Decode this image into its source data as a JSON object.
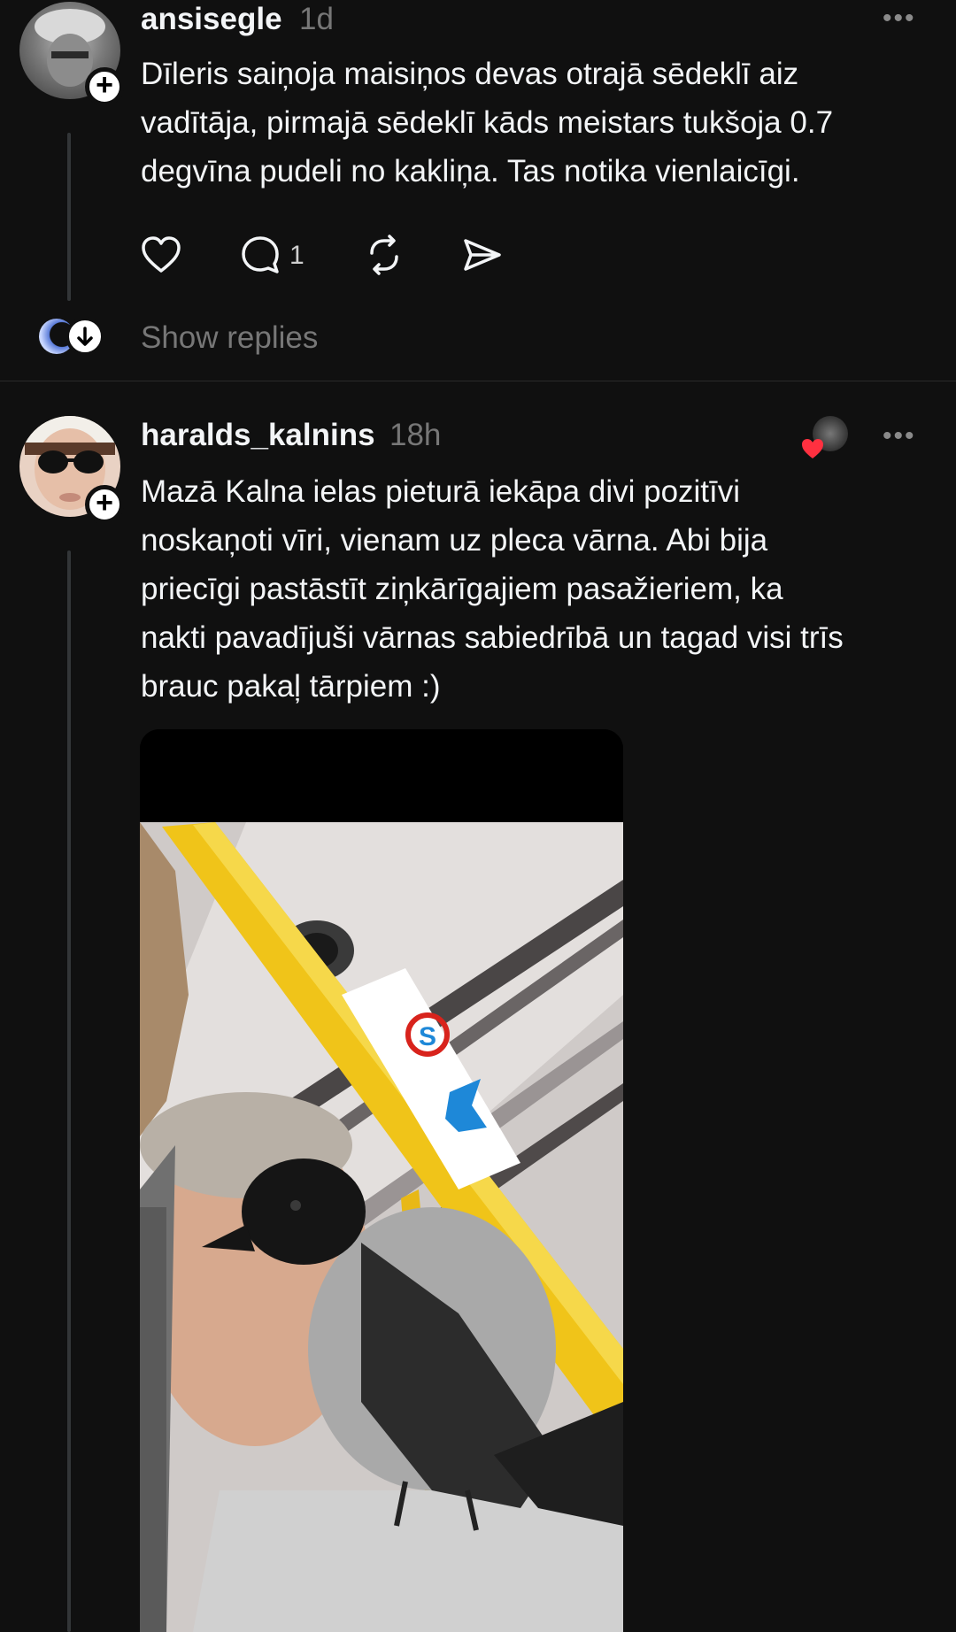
{
  "post1": {
    "username": "ansisegle",
    "time": "1d",
    "text": "Dīleris saiņoja maisiņos devas otrajā sēdeklī aiz\nvadītāja, pirmajā sēdeklī kāds meistars tukšoja 0.7\ndegvīna pudeli no kakliņa. Tas notika vienlaicīgi.",
    "actions": {
      "like_icon": "heart-icon",
      "reply_icon": "comment-icon",
      "reply_count": "1",
      "repost_icon": "repost-icon",
      "share_icon": "send-icon"
    },
    "show_replies_label": "Show replies",
    "more_icon": "more-dots-icon"
  },
  "post2": {
    "username": "haralds_kalnins",
    "time": "18h",
    "text": "Mazā Kalna ielas pieturā iekāpa divi pozitīvi\nnoskaņoti vīri, vienam uz pleca vārna. Abi bija\npriecīgi pastāstīt ziņkārīgajiem pasažieriem, ka\nnakti pavadījuši vārnas sabiedrībā un tagad visi trīs\nbrauc pakaļ tārpiem :)",
    "liked_by_icon": "liked-by-avatar-heart",
    "more_icon": "more-dots-icon"
  },
  "colors": {
    "background": "#101010",
    "text": "#f3f5f7",
    "muted": "#777777",
    "heart": "#ff3040"
  }
}
